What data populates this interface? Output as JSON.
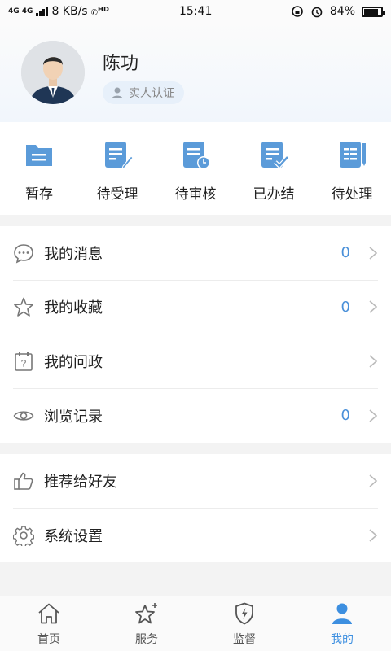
{
  "status_bar": {
    "signal": "4G 4G",
    "speed": "8 KB/s",
    "hd": "HD",
    "time": "15:41",
    "battery": "84%",
    "battery_level": 0.84
  },
  "profile": {
    "name": "陈功",
    "verify_label": "实人认证"
  },
  "actions": [
    {
      "label": "暂存",
      "icon": "folder-icon"
    },
    {
      "label": "待受理",
      "icon": "edit-document-icon"
    },
    {
      "label": "待审核",
      "icon": "clock-document-icon"
    },
    {
      "label": "已办结",
      "icon": "check-document-icon"
    },
    {
      "label": "待处理",
      "icon": "pen-document-icon"
    }
  ],
  "list1": [
    {
      "label": "我的消息",
      "count": "0",
      "icon": "message-icon"
    },
    {
      "label": "我的收藏",
      "count": "0",
      "icon": "star-icon"
    },
    {
      "label": "我的问政",
      "count": "",
      "icon": "question-icon"
    },
    {
      "label": "浏览记录",
      "count": "0",
      "icon": "eye-icon"
    }
  ],
  "list2": [
    {
      "label": "推荐给好友",
      "icon": "thumbs-up-icon"
    },
    {
      "label": "系统设置",
      "icon": "gear-icon"
    }
  ],
  "tabs": [
    {
      "label": "首页",
      "icon": "home-icon",
      "active": false
    },
    {
      "label": "服务",
      "icon": "star-service-icon",
      "active": false
    },
    {
      "label": "监督",
      "icon": "shield-icon",
      "active": false
    },
    {
      "label": "我的",
      "icon": "person-icon",
      "active": true
    }
  ],
  "colors": {
    "accent": "#3d8fe0",
    "icon_blue": "#5b9bd9",
    "count": "#4a90d9"
  }
}
